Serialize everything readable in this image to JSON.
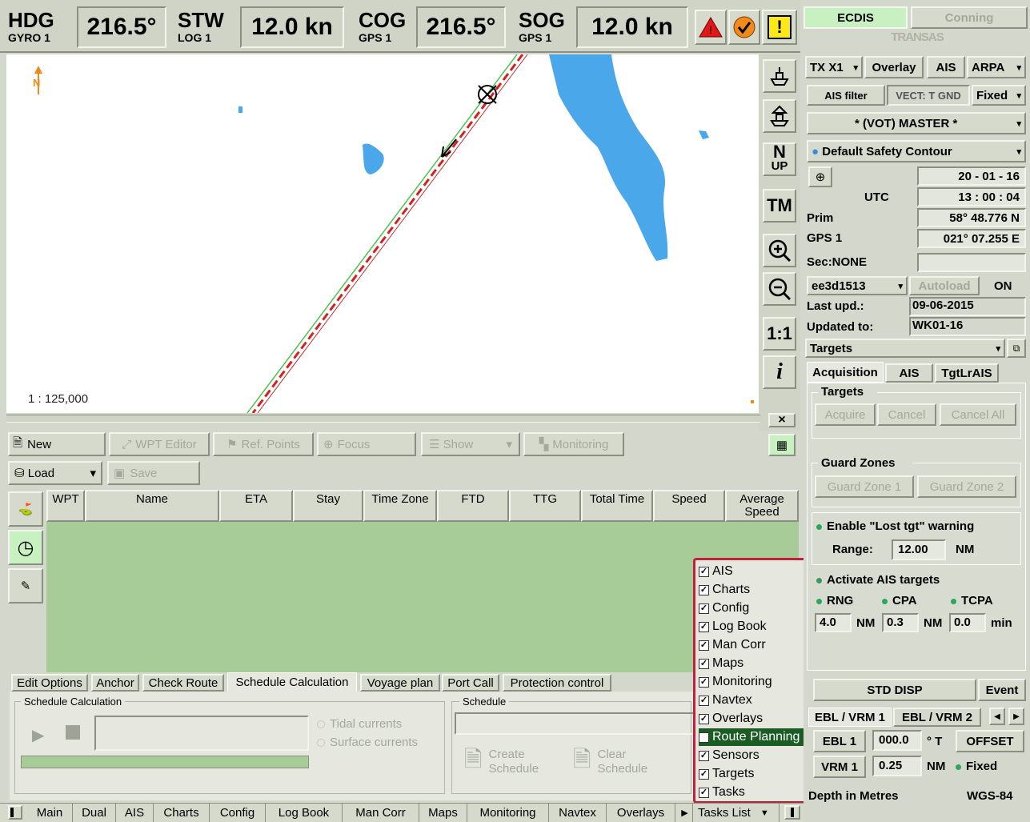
{
  "topbar": {
    "hdg_label": "HDG",
    "hdg_sub": "GYRO 1",
    "hdg_value": "216.5°",
    "stw_label": "STW",
    "stw_sub": "LOG 1",
    "stw_value": "12.0 kn",
    "cog_label": "COG",
    "cog_sub": "GPS 1",
    "cog_value": "216.5°",
    "sog_label": "SOG",
    "sog_sub": "GPS 1",
    "sog_value": "12.0 kn",
    "alarm_warning_symbol": "!"
  },
  "mode_tabs": {
    "ecdis": "ECDIS",
    "conning": "Conning",
    "brand": "TRANSAS"
  },
  "chart": {
    "north_label": "N",
    "scale": "1 : 125,000"
  },
  "chart_tools": {
    "north_up": "N",
    "north_up_sub": "UP",
    "true_motion": "TM",
    "one_to_one": "1:1",
    "info": "i",
    "close": "×"
  },
  "route_toolbar": {
    "new": "New",
    "wpt_editor": "WPT Editor",
    "ref_points": "Ref. Points",
    "focus": "Focus",
    "show": "Show",
    "monitoring": "Monitoring",
    "load": "Load",
    "save": "Save"
  },
  "table": {
    "columns": [
      "WPT",
      "Name",
      "ETA",
      "Stay",
      "Time Zone",
      "FTD",
      "TTG",
      "Total Time",
      "Speed",
      "Average Speed"
    ]
  },
  "bottom_tabs": [
    "Edit Options",
    "Anchor",
    "Check Route",
    "Schedule Calculation",
    "Voyage plan",
    "Port Call",
    "Protection control"
  ],
  "schedule_calc": {
    "group": "Schedule Calculation",
    "tidal": "Tidal currents",
    "surface": "Surface currents"
  },
  "schedule": {
    "group": "Schedule",
    "create": "Create Schedule",
    "clear": "Clear Schedule"
  },
  "tasks_menu": {
    "items": [
      {
        "label": "AIS",
        "checked": true
      },
      {
        "label": "Charts",
        "checked": true
      },
      {
        "label": "Config",
        "checked": true
      },
      {
        "label": "Log Book",
        "checked": true
      },
      {
        "label": "Man Corr",
        "checked": true
      },
      {
        "label": "Maps",
        "checked": true
      },
      {
        "label": "Monitoring",
        "checked": true
      },
      {
        "label": "Navtex",
        "checked": true
      },
      {
        "label": "Overlays",
        "checked": true
      },
      {
        "label": "Route Planning",
        "checked": true
      },
      {
        "label": "Sensors",
        "checked": true
      },
      {
        "label": "Targets",
        "checked": true
      },
      {
        "label": "Tasks",
        "checked": true
      }
    ],
    "highlight_color": "#1a5c24",
    "border_color": "#c0203a"
  },
  "taskbar": {
    "tabs": [
      "Main",
      "Dual",
      "AIS",
      "Charts",
      "Config",
      "Log Book",
      "Man Corr",
      "Maps",
      "Monitoring",
      "Navtex",
      "Overlays"
    ],
    "tasks_list": "Tasks List"
  },
  "right_panel": {
    "tx": "TX X1",
    "overlay": "Overlay",
    "ais": "AIS",
    "arpa": "ARPA",
    "ais_filter": "AIS filter",
    "vect": "VECT: T GND",
    "fixed": "Fixed",
    "master": "* (VOT) MASTER *",
    "safety": "Default Safety Contour",
    "date": "20 - 01 - 16",
    "utc": "UTC",
    "time": "13 : 00 : 04",
    "prim": "Prim",
    "gps": "GPS 1",
    "lat": "58° 48.776 N",
    "lon": "021° 07.255 E",
    "sec": "Sec:NONE",
    "cell": "ee3d1513",
    "autoload": "Autoload",
    "on": "ON",
    "last_upd_label": "Last upd.:",
    "last_upd": "09-06-2015",
    "updated_to_label": "Updated to:",
    "updated_to": "WK01-16",
    "targets_dropdown": "Targets",
    "tabs": [
      "Acquisition",
      "AIS",
      "TgtLrAIS"
    ],
    "targets_group": "Targets",
    "acquire": "Acquire",
    "cancel": "Cancel",
    "cancel_all": "Cancel All",
    "guard_group": "Guard Zones",
    "guard1": "Guard Zone 1",
    "guard2": "Guard Zone 2",
    "lost_tgt": "Enable \"Lost tgt\" warning",
    "range_label": "Range:",
    "range_value": "12.00",
    "range_unit": "NM",
    "activate": "Activate AIS targets",
    "rng": "RNG",
    "cpa": "CPA",
    "tcpa": "TCPA",
    "rng_value": "4.0",
    "rng_unit": "NM",
    "cpa_value": "0.3",
    "cpa_unit": "NM",
    "tcpa_value": "0.0",
    "tcpa_unit": "min",
    "std_disp": "STD DISP",
    "event": "Event",
    "ebl_tab1": "EBL / VRM 1",
    "ebl_tab2": "EBL / VRM 2",
    "ebl": "EBL 1",
    "ebl_value": "000.0",
    "ebl_unit": "° T",
    "offset": "OFFSET",
    "vrm": "VRM 1",
    "vrm_value": "0.25",
    "vrm_unit": "NM",
    "vrm_fixed": "Fixed",
    "depth": "Depth in Metres",
    "datum": "WGS-84"
  }
}
